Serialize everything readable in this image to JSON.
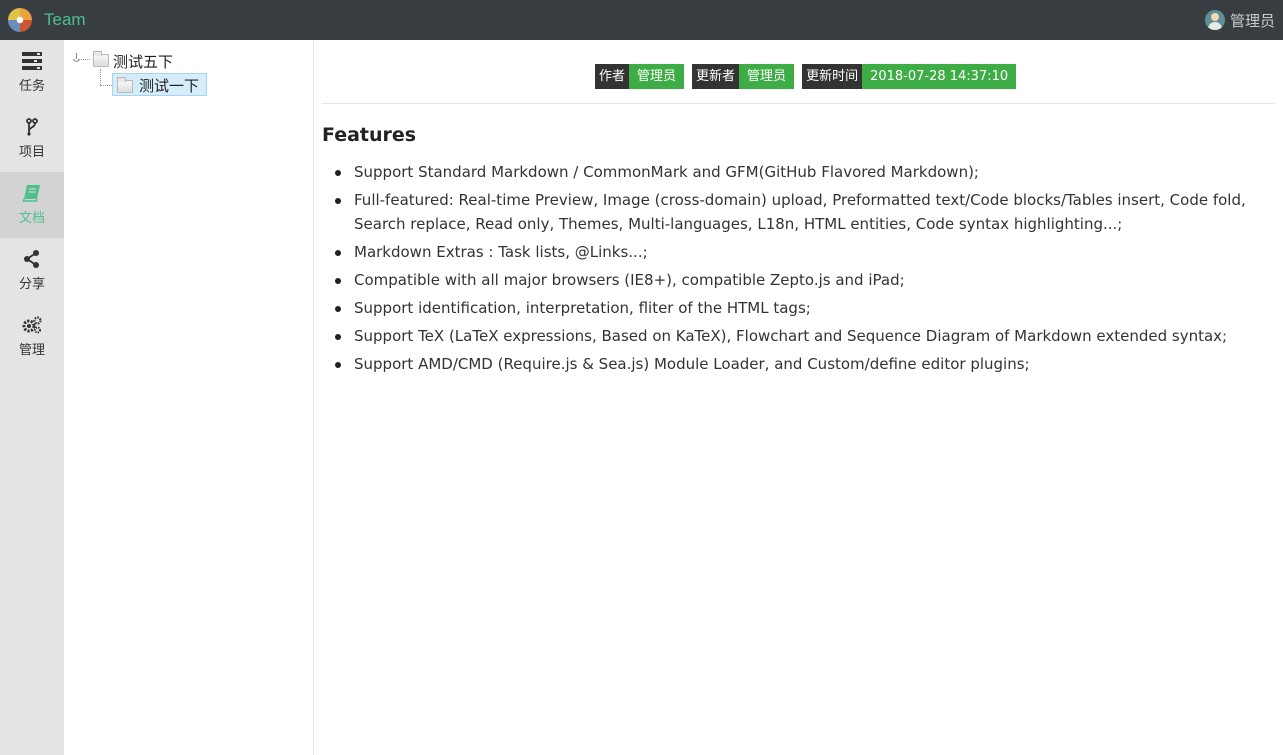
{
  "app": {
    "title": "Team"
  },
  "user": {
    "name": "管理员"
  },
  "nav": {
    "items": [
      {
        "label": "任务",
        "icon": "task-list-icon"
      },
      {
        "label": "项目",
        "icon": "branch-icon"
      },
      {
        "label": "文档",
        "icon": "book-icon",
        "active": true
      },
      {
        "label": "分享",
        "icon": "share-icon"
      },
      {
        "label": "管理",
        "icon": "gears-icon"
      }
    ]
  },
  "tree": {
    "root": {
      "label": "测试五下"
    },
    "child": {
      "label": "测试一下",
      "selected": true
    }
  },
  "meta": {
    "author_key": "作者",
    "author_value": "管理员",
    "updater_key": "更新者",
    "updater_value": "管理员",
    "time_key": "更新时间",
    "time_value": "2018-07-28 14:37:10"
  },
  "doc": {
    "title": "Features",
    "items": [
      "Support Standard Markdown / CommonMark and GFM(GitHub Flavored Markdown);",
      "Full-featured: Real-time Preview, Image (cross-domain) upload, Preformatted text/Code blocks/Tables insert, Code fold, Search replace, Read only, Themes, Multi-languages, L18n, HTML entities, Code syntax highlighting...;",
      "Markdown Extras : Task lists, @Links...;",
      "Compatible with all major browsers (IE8+), compatible Zepto.js and iPad;",
      "Support identification, interpretation, fliter of the HTML tags;",
      "Support TeX (LaTeX expressions, Based on KaTeX), Flowchart and Sequence Diagram of Markdown extended syntax;",
      "Support AMD/CMD (Require.js & Sea.js) Module Loader, and Custom/define editor plugins;"
    ]
  },
  "colors": {
    "topbar": "#373d41",
    "accent": "#4fc08d",
    "tag_value": "#3fad46",
    "tag_key": "#333333"
  }
}
